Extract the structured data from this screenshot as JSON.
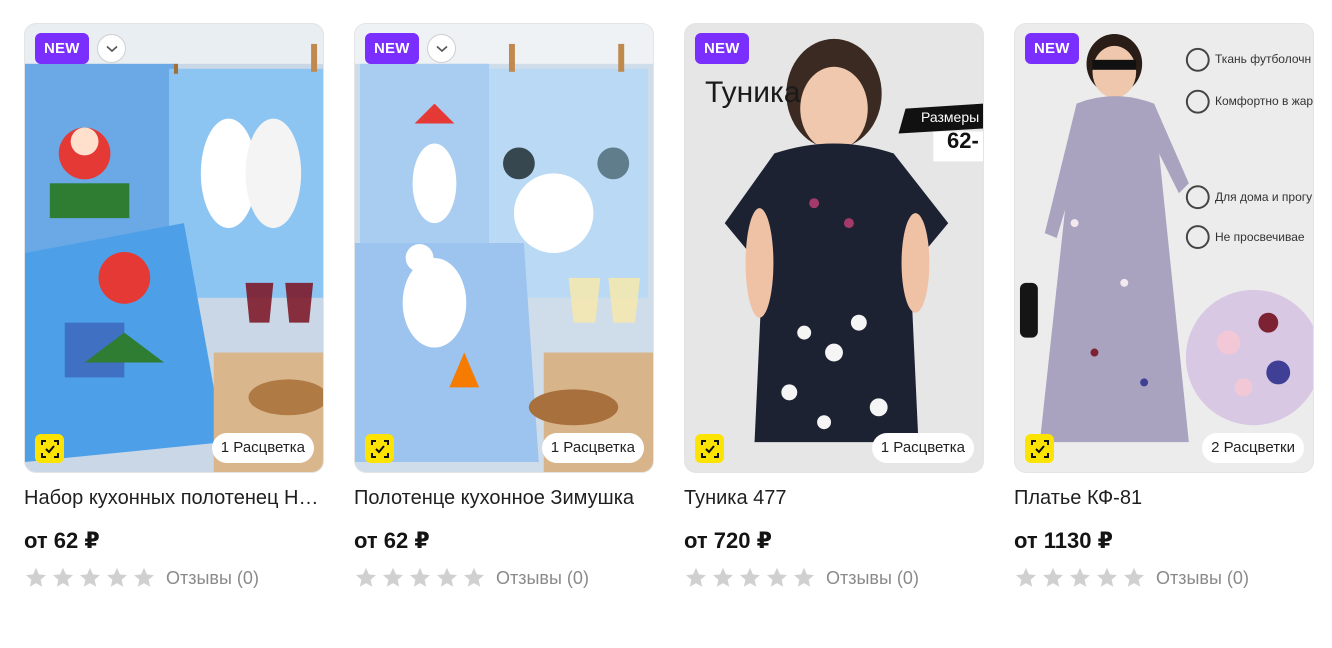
{
  "products": [
    {
      "badge": "NEW",
      "has_menu": true,
      "colors": "1 Расцветка",
      "title": "Набор кухонных полотенец Новогодний",
      "price": "от 62 ₽",
      "rating": 0,
      "reviews": "Отзывы (0)",
      "image_text": []
    },
    {
      "badge": "NEW",
      "has_menu": true,
      "colors": "1 Расцветка",
      "title": "Полотенце кухонное Зимушка",
      "price": "от 62 ₽",
      "rating": 0,
      "reviews": "Отзывы (0)",
      "image_text": []
    },
    {
      "badge": "NEW",
      "has_menu": false,
      "colors": "1 Расцветка",
      "title": "Туника 477",
      "price": "от 720 ₽",
      "rating": 0,
      "reviews": "Отзывы (0)",
      "image_text": [
        "Туника",
        "Размеры",
        "62-"
      ]
    },
    {
      "badge": "NEW",
      "has_menu": false,
      "colors": "2 Расцветки",
      "title": "Платье КФ-81",
      "price": "от 1130 ₽",
      "rating": 0,
      "reviews": "Отзывы (0)",
      "image_text": [
        "Ткань футболочн",
        "Комфортно в жар",
        "Для дома и прогу",
        "Не просвечивае"
      ]
    }
  ],
  "colors": {
    "badge_bg": "#7a2fff",
    "scan_bg": "#fde400",
    "star_empty": "#d0d0d0",
    "reviews_text": "#8a8a8a"
  }
}
